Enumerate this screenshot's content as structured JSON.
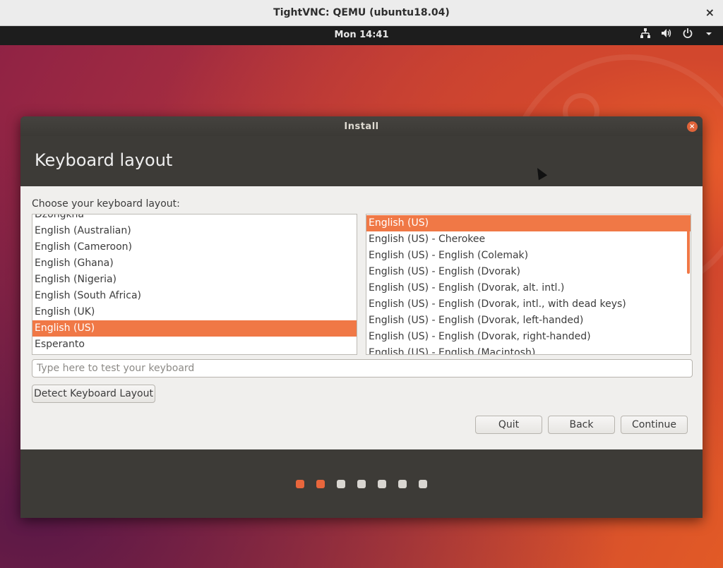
{
  "vnc": {
    "title": "TightVNC: QEMU (ubuntu18.04)",
    "close_icon": "×"
  },
  "panel": {
    "clock": "Mon 14:41",
    "tray_icons": [
      "network-icon",
      "volume-icon",
      "power-icon",
      "chevron-down-icon"
    ]
  },
  "installer": {
    "window_title": "Install",
    "close_icon": "×",
    "page_title": "Keyboard layout",
    "choose_label": "Choose your keyboard layout:",
    "left_list": [
      "Dzongkha",
      "English (Australian)",
      "English (Cameroon)",
      "English (Ghana)",
      "English (Nigeria)",
      "English (South Africa)",
      "English (UK)",
      "English (US)",
      "Esperanto"
    ],
    "left_selected": "English (US)",
    "right_list": [
      "English (US)",
      "English (US) - Cherokee",
      "English (US) - English (Colemak)",
      "English (US) - English (Dvorak)",
      "English (US) - English (Dvorak, alt. intl.)",
      "English (US) - English (Dvorak, intl., with dead keys)",
      "English (US) - English (Dvorak, left-handed)",
      "English (US) - English (Dvorak, right-handed)",
      "English (US) - English (Macintosh)"
    ],
    "right_selected": "English (US)",
    "test_placeholder": "Type here to test your keyboard",
    "test_value": "",
    "detect_button": "Detect Keyboard Layout",
    "quit_button": "Quit",
    "back_button": "Back",
    "continue_button": "Continue",
    "progress": {
      "total_steps": 7,
      "completed_steps": 2
    }
  },
  "colors": {
    "accent": "#f07846",
    "dark_panel": "#3d3b37",
    "content_bg": "#f0efed"
  }
}
